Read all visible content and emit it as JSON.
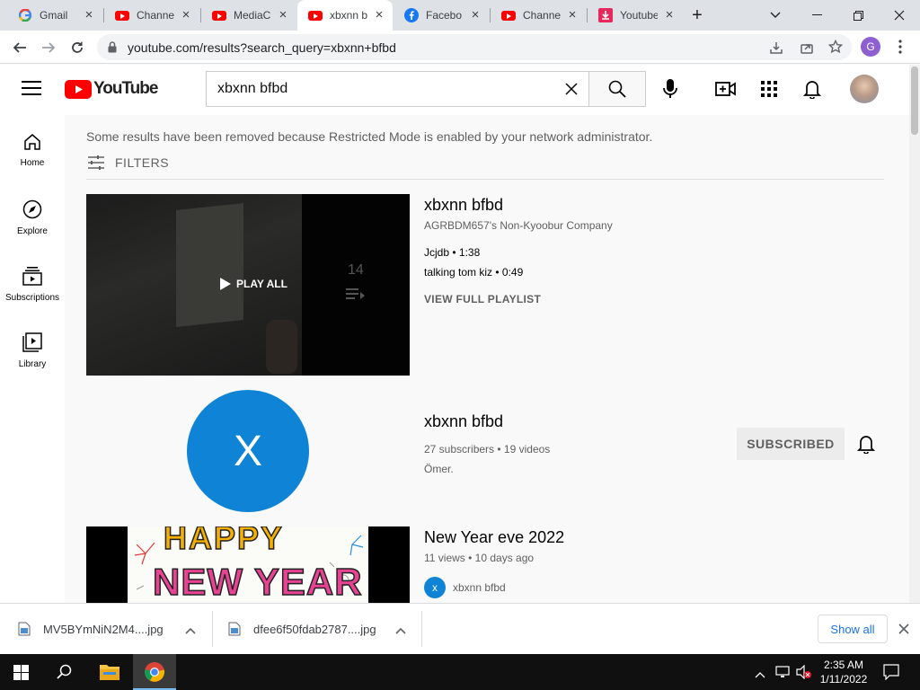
{
  "browser": {
    "tabs": [
      {
        "title": "Gmail",
        "icon": "gmail-icon"
      },
      {
        "title": "Channel",
        "icon": "youtube-icon"
      },
      {
        "title": "MediaC",
        "icon": "youtube-icon"
      },
      {
        "title": "xbxnn b",
        "icon": "youtube-icon",
        "active": true
      },
      {
        "title": "Facebo",
        "icon": "facebook-icon"
      },
      {
        "title": "Channel",
        "icon": "youtube-icon"
      },
      {
        "title": "Youtube",
        "icon": "download-icon"
      }
    ],
    "url": "youtube.com/results?search_query=xbxnn+bfbd",
    "profile_initial": "G"
  },
  "youtube": {
    "logo_text": "YouTube",
    "search_value": "xbxnn bfbd",
    "sidebar": [
      {
        "label": "Home",
        "icon": "home-icon"
      },
      {
        "label": "Explore",
        "icon": "compass-icon"
      },
      {
        "label": "Subscriptions",
        "icon": "subscriptions-icon"
      },
      {
        "label": "Library",
        "icon": "library-icon"
      }
    ],
    "restricted_notice": "Some results have been removed because Restricted Mode is enabled by your network administrator.",
    "filters_label": "FILTERS",
    "playlist": {
      "title": "xbxnn bfbd",
      "channel": "AGRBDM657's Non-Kyoobur Company",
      "items": [
        {
          "name": "Jcjdb",
          "duration": "1:38"
        },
        {
          "name": "talking tom kiz",
          "duration": "0:49"
        }
      ],
      "view_full": "VIEW FULL PLAYLIST",
      "play_all": "PLAY ALL",
      "count": "14"
    },
    "channel": {
      "avatar_letter": "X",
      "title": "xbxnn bfbd",
      "subscribers": "27 subscribers",
      "videos": "19 videos",
      "description": "Ömer.",
      "subscribe_label": "SUBSCRIBED"
    },
    "video": {
      "title": "New Year eve 2022",
      "views": "11 views",
      "age": "10 days ago",
      "channel": "xbxnn bfbd",
      "channel_letter": "x",
      "thumb_line1": "HAPPY",
      "thumb_line2": "NEW YEAR"
    }
  },
  "downloads": {
    "items": [
      "MV5BYmNiN2M4....jpg",
      "dfee6f50fdab2787....jpg"
    ],
    "show_all": "Show all"
  },
  "taskbar": {
    "time": "2:35 AM",
    "date": "1/11/2022"
  },
  "colors": {
    "youtube_red": "#ff0000",
    "channel_blue": "#0f84d6",
    "taskbar": "#101010"
  }
}
